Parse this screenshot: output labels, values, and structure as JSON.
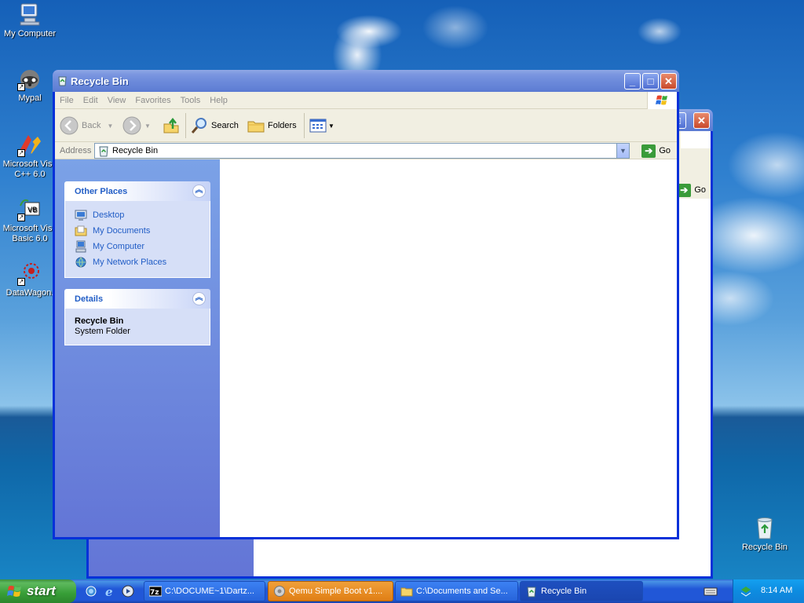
{
  "desktop": {
    "icons": [
      {
        "label": "My Computer"
      },
      {
        "label": "Mypal"
      },
      {
        "label": "Microsoft Visu C++ 6.0"
      },
      {
        "label": "Microsoft Visu Basic 6.0"
      },
      {
        "label": "DataWagon."
      },
      {
        "label": "Recycle Bin"
      }
    ]
  },
  "window": {
    "title": "Recycle Bin",
    "controls": {
      "minimize": "_",
      "maximize": "□",
      "close": "✕"
    },
    "menu": [
      "File",
      "Edit",
      "View",
      "Favorites",
      "Tools",
      "Help"
    ],
    "toolbar": {
      "back": "Back",
      "search": "Search",
      "folders": "Folders"
    },
    "address": {
      "label": "Address",
      "value": "Recycle Bin",
      "go": "Go"
    },
    "taskpane": {
      "other_places": {
        "title": "Other Places",
        "links": [
          "Desktop",
          "My Documents",
          "My Computer",
          "My Network Places"
        ]
      },
      "details": {
        "title": "Details",
        "name": "Recycle Bin",
        "type": "System Folder"
      }
    }
  },
  "back_window": {
    "go": "Go"
  },
  "taskbar": {
    "start": "start",
    "tasks": [
      {
        "label": "C:\\DOCUME~1\\Dartz..."
      },
      {
        "label": "Qemu Simple Boot v1...."
      },
      {
        "label": "C:\\Documents and Se..."
      },
      {
        "label": "Recycle Bin"
      }
    ],
    "clock": "8:14 AM"
  },
  "colors": {
    "title_bar": "#6382d6",
    "task_active": "#e07e14",
    "link": "#215dc6",
    "start_green": "#379e37"
  }
}
